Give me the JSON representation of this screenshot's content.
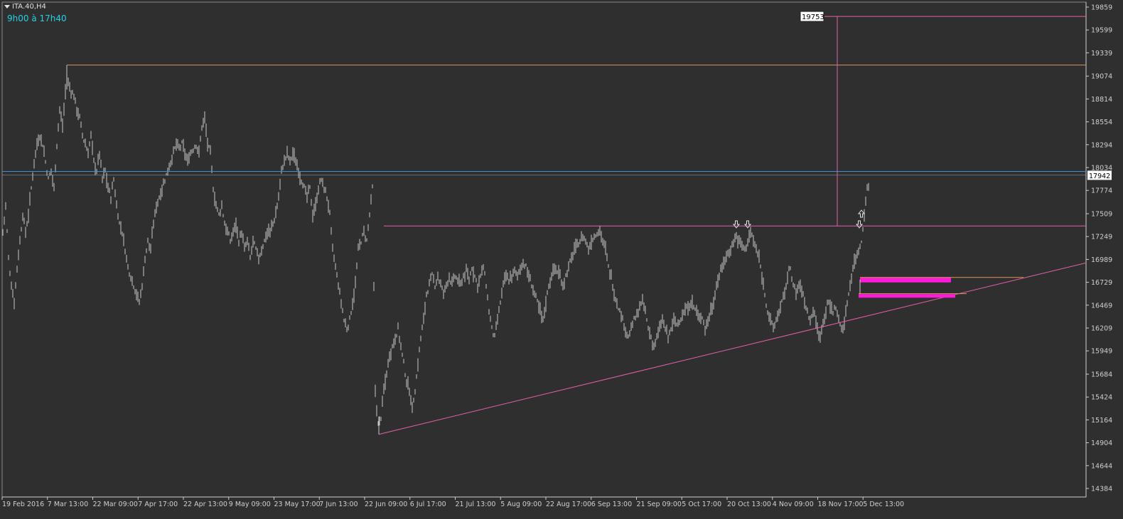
{
  "header": {
    "symbol": "ITA.40,H4",
    "session_text": "9h00 à 17h40"
  },
  "colors": {
    "background": "#2f2f2f",
    "bars": "#c8c8c8",
    "axis": "#cfcfcf",
    "resistance_line": "#e65fa8",
    "trend_line": "#e65fa8",
    "high_line": "#d8955a",
    "blue_line": "#3a8fd6",
    "zone": "#ff1ad9",
    "price_label_bg": "#ffffff"
  },
  "chart_data": {
    "type": "candlestick",
    "price_ticks": [
      "19859",
      "19599",
      "19339",
      "19074",
      "18814",
      "18554",
      "18294",
      "18034",
      "17774",
      "17509",
      "17249",
      "16989",
      "16729",
      "16469",
      "16209",
      "15949",
      "15684",
      "15424",
      "15164",
      "14904",
      "14644",
      "14384"
    ],
    "time_ticks": [
      "19 Feb 2016",
      "7 Mar 13:00",
      "22 Mar 09:00",
      "7 Apr 17:00",
      "22 Apr 13:00",
      "9 May 09:00",
      "23 May 17:00",
      "7 Jun 13:00",
      "22 Jun 09:00",
      "6 Jul 17:00",
      "21 Jul 13:00",
      "5 Aug 09:00",
      "22 Aug 17:00",
      "6 Sep 13:00",
      "21 Sep 09:00",
      "5 Oct 17:00",
      "20 Oct 13:00",
      "4 Nov 09:00",
      "18 Nov 17:00",
      "5 Dec 13:00"
    ],
    "ylim": [
      14384,
      19859
    ],
    "current_price": "17942",
    "target_label": "19753",
    "levels": {
      "target": 19753,
      "march_high": 19200,
      "blue_line": 17990,
      "resistance": 17370,
      "zone_upper": 16760,
      "zone_lower": 16570,
      "orange_small": 16600
    },
    "trend_line": {
      "start": [
        "22 Jun 09:00",
        15000
      ],
      "end": [
        "5 Dec 13:00",
        16780
      ]
    },
    "fractal_marks": [
      "20 Oct",
      "21 Oct",
      "5 Dec"
    ],
    "path": [
      [
        0,
        17300
      ],
      [
        4,
        17600
      ],
      [
        8,
        17000
      ],
      [
        12,
        16700
      ],
      [
        16,
        16500
      ],
      [
        20,
        16900
      ],
      [
        24,
        17200
      ],
      [
        28,
        17500
      ],
      [
        32,
        17300
      ],
      [
        36,
        17500
      ],
      [
        40,
        17800
      ],
      [
        44,
        18100
      ],
      [
        48,
        18300
      ],
      [
        52,
        18400
      ],
      [
        56,
        18300
      ],
      [
        60,
        18100
      ],
      [
        64,
        17900
      ],
      [
        68,
        18000
      ],
      [
        72,
        17800
      ],
      [
        76,
        18300
      ],
      [
        80,
        18700
      ],
      [
        84,
        18500
      ],
      [
        88,
        18900
      ],
      [
        92,
        19000
      ],
      [
        96,
        18900
      ],
      [
        100,
        18850
      ],
      [
        104,
        18700
      ],
      [
        108,
        18600
      ],
      [
        112,
        18400
      ],
      [
        116,
        18300
      ],
      [
        120,
        18200
      ],
      [
        124,
        18400
      ],
      [
        128,
        18100
      ],
      [
        132,
        18000
      ],
      [
        136,
        18200
      ],
      [
        140,
        17900
      ],
      [
        144,
        18000
      ],
      [
        148,
        17800
      ],
      [
        152,
        17700
      ],
      [
        156,
        17900
      ],
      [
        160,
        17600
      ],
      [
        164,
        17400
      ],
      [
        168,
        17300
      ],
      [
        172,
        17100
      ],
      [
        176,
        16900
      ],
      [
        180,
        16800
      ],
      [
        184,
        16700
      ],
      [
        188,
        16600
      ],
      [
        192,
        16500
      ],
      [
        196,
        16700
      ],
      [
        200,
        17000
      ],
      [
        204,
        17200
      ],
      [
        208,
        17100
      ],
      [
        212,
        17400
      ],
      [
        216,
        17600
      ],
      [
        220,
        17700
      ],
      [
        224,
        17800
      ],
      [
        228,
        17900
      ],
      [
        232,
        18000
      ],
      [
        236,
        18100
      ],
      [
        240,
        18200
      ],
      [
        244,
        18300
      ],
      [
        248,
        18250
      ],
      [
        252,
        18300
      ],
      [
        256,
        18200
      ],
      [
        260,
        18100
      ],
      [
        264,
        18200
      ],
      [
        268,
        18250
      ],
      [
        272,
        18300
      ],
      [
        276,
        18200
      ],
      [
        280,
        18500
      ],
      [
        284,
        18600
      ],
      [
        288,
        18300
      ],
      [
        292,
        18200
      ],
      [
        296,
        17800
      ],
      [
        300,
        17600
      ],
      [
        304,
        17500
      ],
      [
        308,
        17600
      ],
      [
        312,
        17400
      ],
      [
        316,
        17300
      ],
      [
        320,
        17200
      ],
      [
        324,
        17300
      ],
      [
        328,
        17400
      ],
      [
        332,
        17200
      ],
      [
        336,
        17300
      ],
      [
        340,
        17100
      ],
      [
        344,
        17200
      ],
      [
        348,
        17000
      ],
      [
        352,
        17200
      ],
      [
        356,
        17100
      ],
      [
        360,
        17000
      ],
      [
        364,
        17100
      ],
      [
        368,
        17200
      ],
      [
        372,
        17300
      ],
      [
        376,
        17300
      ],
      [
        380,
        17400
      ],
      [
        384,
        17500
      ],
      [
        388,
        17700
      ],
      [
        392,
        18000
      ],
      [
        396,
        18100
      ],
      [
        400,
        18200
      ],
      [
        404,
        18100
      ],
      [
        408,
        18200
      ],
      [
        412,
        18100
      ],
      [
        416,
        18000
      ],
      [
        420,
        17900
      ],
      [
        424,
        17800
      ],
      [
        428,
        17700
      ],
      [
        432,
        17800
      ],
      [
        436,
        17500
      ],
      [
        440,
        17600
      ],
      [
        444,
        17800
      ],
      [
        448,
        17900
      ],
      [
        452,
        17800
      ],
      [
        456,
        17700
      ],
      [
        460,
        17500
      ],
      [
        464,
        17100
      ],
      [
        468,
        16900
      ],
      [
        472,
        16700
      ],
      [
        476,
        16500
      ],
      [
        480,
        16300
      ],
      [
        484,
        16200
      ],
      [
        488,
        16300
      ],
      [
        492,
        16500
      ],
      [
        496,
        16700
      ],
      [
        500,
        17100
      ],
      [
        504,
        17200
      ],
      [
        508,
        17300
      ],
      [
        512,
        17200
      ],
      [
        516,
        17500
      ],
      [
        520,
        17800
      ],
      [
        524,
        15500
      ],
      [
        528,
        15100
      ],
      [
        532,
        15200
      ],
      [
        536,
        15500
      ],
      [
        540,
        15700
      ],
      [
        544,
        15900
      ],
      [
        548,
        16000
      ],
      [
        552,
        16100
      ],
      [
        556,
        16200
      ],
      [
        560,
        16000
      ],
      [
        564,
        15800
      ],
      [
        568,
        15600
      ],
      [
        572,
        15500
      ],
      [
        576,
        15300
      ],
      [
        580,
        15500
      ],
      [
        584,
        15800
      ],
      [
        588,
        16100
      ],
      [
        592,
        16300
      ],
      [
        596,
        16600
      ],
      [
        600,
        16700
      ],
      [
        604,
        16800
      ],
      [
        608,
        16700
      ],
      [
        612,
        16800
      ],
      [
        616,
        16700
      ],
      [
        620,
        16600
      ],
      [
        624,
        16700
      ],
      [
        628,
        16800
      ],
      [
        632,
        16700
      ],
      [
        636,
        16800
      ],
      [
        640,
        16750
      ],
      [
        644,
        16700
      ],
      [
        648,
        16800
      ],
      [
        652,
        16850
      ],
      [
        656,
        16750
      ],
      [
        660,
        16900
      ],
      [
        664,
        16800
      ],
      [
        668,
        16700
      ],
      [
        672,
        16800
      ],
      [
        676,
        16900
      ],
      [
        680,
        16700
      ],
      [
        684,
        16400
      ],
      [
        688,
        16200
      ],
      [
        692,
        16100
      ],
      [
        696,
        16300
      ],
      [
        700,
        16500
      ],
      [
        704,
        16700
      ],
      [
        708,
        16800
      ],
      [
        712,
        16750
      ],
      [
        716,
        16800
      ],
      [
        720,
        16850
      ],
      [
        724,
        16800
      ],
      [
        728,
        16900
      ],
      [
        732,
        16950
      ],
      [
        736,
        16900
      ],
      [
        740,
        16800
      ],
      [
        744,
        16700
      ],
      [
        748,
        16600
      ],
      [
        752,
        16500
      ],
      [
        756,
        16400
      ],
      [
        760,
        16300
      ],
      [
        764,
        16500
      ],
      [
        768,
        16700
      ],
      [
        772,
        16800
      ],
      [
        776,
        16900
      ],
      [
        780,
        16850
      ],
      [
        784,
        16800
      ],
      [
        788,
        16700
      ],
      [
        792,
        16800
      ],
      [
        796,
        16900
      ],
      [
        800,
        17000
      ],
      [
        804,
        17100
      ],
      [
        808,
        17150
      ],
      [
        812,
        17200
      ],
      [
        816,
        17250
      ],
      [
        820,
        17200
      ],
      [
        824,
        17100
      ],
      [
        828,
        17200
      ],
      [
        832,
        17250
      ],
      [
        836,
        17300
      ],
      [
        840,
        17320
      ],
      [
        844,
        17200
      ],
      [
        848,
        17100
      ],
      [
        852,
        16900
      ],
      [
        856,
        16800
      ],
      [
        860,
        16600
      ],
      [
        864,
        16500
      ],
      [
        868,
        16400
      ],
      [
        872,
        16300
      ],
      [
        876,
        16200
      ],
      [
        880,
        16100
      ],
      [
        884,
        16200
      ],
      [
        888,
        16300
      ],
      [
        892,
        16350
      ],
      [
        896,
        16450
      ],
      [
        900,
        16500
      ],
      [
        904,
        16400
      ],
      [
        908,
        16200
      ],
      [
        912,
        16100
      ],
      [
        916,
        16000
      ],
      [
        920,
        16100
      ],
      [
        924,
        16200
      ],
      [
        928,
        16300
      ],
      [
        932,
        16200
      ],
      [
        936,
        16100
      ],
      [
        940,
        16200
      ],
      [
        944,
        16300
      ],
      [
        948,
        16250
      ],
      [
        952,
        16300
      ],
      [
        956,
        16350
      ],
      [
        960,
        16400
      ],
      [
        964,
        16450
      ],
      [
        968,
        16500
      ],
      [
        972,
        16450
      ],
      [
        976,
        16400
      ],
      [
        980,
        16300
      ],
      [
        984,
        16350
      ],
      [
        988,
        16200
      ],
      [
        992,
        16300
      ],
      [
        996,
        16400
      ],
      [
        1000,
        16500
      ],
      [
        1004,
        16700
      ],
      [
        1008,
        16800
      ],
      [
        1012,
        16900
      ],
      [
        1016,
        17000
      ],
      [
        1020,
        17050
      ],
      [
        1024,
        17100
      ],
      [
        1028,
        17200
      ],
      [
        1032,
        17250
      ],
      [
        1036,
        17200
      ],
      [
        1040,
        17150
      ],
      [
        1044,
        17100
      ],
      [
        1048,
        17200
      ],
      [
        1052,
        17300
      ],
      [
        1056,
        17200
      ],
      [
        1060,
        17100
      ],
      [
        1064,
        17000
      ],
      [
        1068,
        16800
      ],
      [
        1072,
        16600
      ],
      [
        1076,
        16400
      ],
      [
        1080,
        16300
      ],
      [
        1084,
        16200
      ],
      [
        1088,
        16300
      ],
      [
        1092,
        16400
      ],
      [
        1096,
        16500
      ],
      [
        1100,
        16600
      ],
      [
        1104,
        16800
      ],
      [
        1108,
        16900
      ],
      [
        1112,
        16700
      ],
      [
        1116,
        16600
      ],
      [
        1120,
        16700
      ],
      [
        1124,
        16650
      ],
      [
        1128,
        16500
      ],
      [
        1132,
        16400
      ],
      [
        1136,
        16300
      ],
      [
        1140,
        16400
      ],
      [
        1144,
        16300
      ],
      [
        1148,
        16100
      ],
      [
        1152,
        16200
      ],
      [
        1156,
        16350
      ],
      [
        1160,
        16500
      ],
      [
        1164,
        16450
      ],
      [
        1168,
        16400
      ],
      [
        1172,
        16450
      ],
      [
        1176,
        16300
      ],
      [
        1180,
        16200
      ],
      [
        1184,
        16250
      ],
      [
        1188,
        16500
      ],
      [
        1192,
        16700
      ],
      [
        1196,
        16900
      ],
      [
        1200,
        17000
      ],
      [
        1204,
        17100
      ],
      [
        1208,
        17200
      ],
      [
        1212,
        17500
      ],
      [
        1216,
        17800
      ],
      [
        1220,
        17900
      ]
    ]
  }
}
